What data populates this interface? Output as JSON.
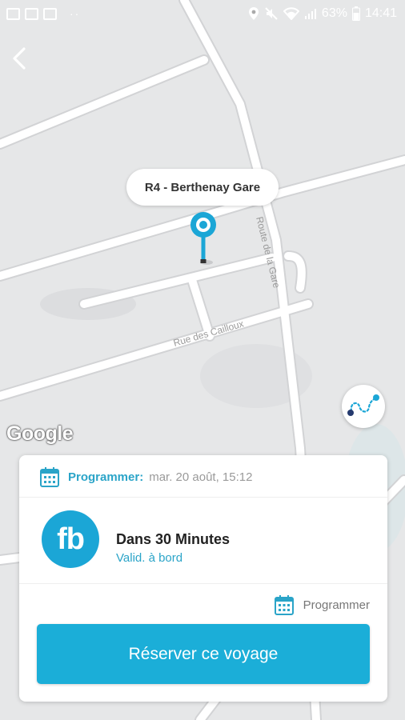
{
  "status_bar": {
    "battery_percent": "63%",
    "time": "14:41",
    "notification_icons": [
      "image-icon",
      "flipboard-icon",
      "flipboard-icon"
    ],
    "more_dots": "··",
    "status_icons": [
      "location-icon",
      "mute-icon",
      "wifi-icon",
      "signal-icon",
      "battery-icon"
    ]
  },
  "map": {
    "stop_label": "R4 - Berthenay Gare",
    "street_labels": [
      "Route de la Gare",
      "Rue des Cailloux"
    ],
    "provider": "Google",
    "colors": {
      "background": "#e6e7e8",
      "roads": "#ffffff",
      "pin": "#1ba6d6"
    }
  },
  "card": {
    "schedule": {
      "label": "Programmer:",
      "value": "mar. 20 août, 15:12"
    },
    "operator_logo_text": "fb",
    "trip_title": "Dans 30 Minutes",
    "trip_subtitle": "Valid. à bord",
    "program_link": "Programmer",
    "reserve_button": "Réserver ce voyage",
    "colors": {
      "accent": "#2aa4c8",
      "button": "#1baed8"
    }
  }
}
